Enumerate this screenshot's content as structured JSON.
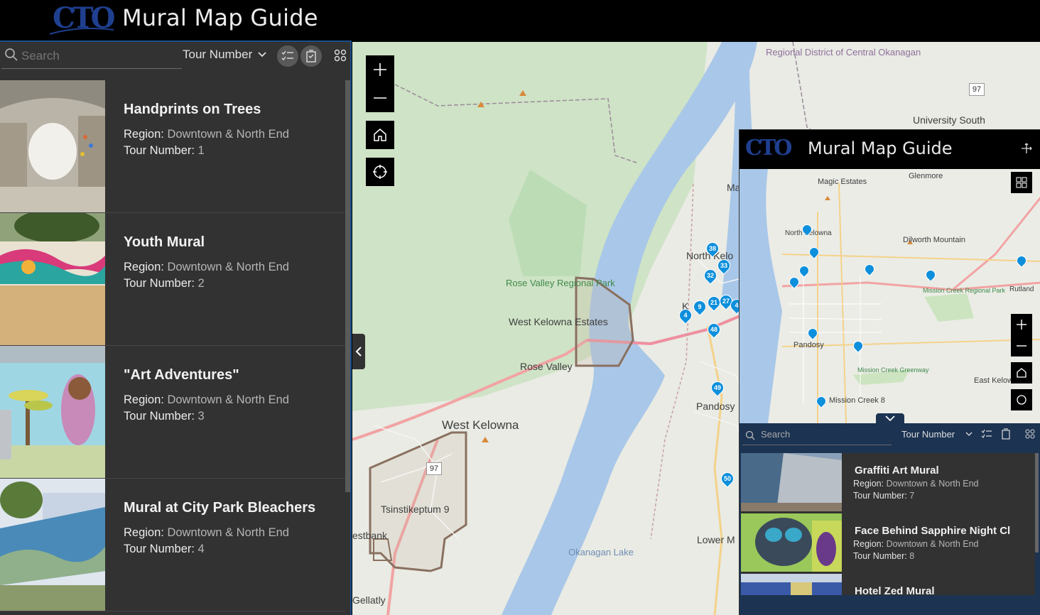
{
  "header": {
    "logo_text": "CTO",
    "title": "Mural Map Guide"
  },
  "toolbar": {
    "search_placeholder": "Search",
    "sort_label": "Tour Number",
    "icons": [
      "search-icon",
      "chevron-down-icon",
      "select-all-icon",
      "clear-selection-icon",
      "grid-view-icon"
    ]
  },
  "murals": [
    {
      "title": "Handprints on Trees",
      "region_label": "Region:",
      "region": "Downtown & North End",
      "tour_label": "Tour Number:",
      "tour": "1"
    },
    {
      "title": "Youth Mural",
      "region_label": "Region:",
      "region": "Downtown & North End",
      "tour_label": "Tour Number:",
      "tour": "2"
    },
    {
      "title": "\"Art Adventures\"",
      "region_label": "Region:",
      "region": "Downtown & North End",
      "tour_label": "Tour Number:",
      "tour": "3"
    },
    {
      "title": "Mural at City Park Bleachers",
      "region_label": "Region:",
      "region": "Downtown & North End",
      "tour_label": "Tour Number:",
      "tour": "4"
    }
  ],
  "map": {
    "controls": [
      "zoom-in-icon",
      "zoom-out-icon",
      "home-icon",
      "locate-icon"
    ],
    "labels": {
      "regional_district": "Regional District of Central Okanagan",
      "university_south": "University South",
      "rose_valley_park": "Rose Valley Regional Park",
      "west_kelowna_estates": "West Kelowna Estates",
      "rose_valley": "Rose Valley",
      "west_kelowna": "West Kelowna",
      "tsinstikeptum": "Tsinstikeptum 9",
      "westbank": "estbank",
      "gellatly": "Gellatly",
      "okanagan_lake": "Okanagan Lake",
      "north_kelowna": "North Kelo",
      "pandosy": "Pandosy",
      "lower_mission": "Lower M",
      "ma": "Ma",
      "k": "K"
    },
    "highways": [
      "97",
      "97"
    ],
    "pins": [
      "38",
      "33",
      "32",
      "21",
      "27",
      "4",
      "9",
      "4",
      "48",
      "49",
      "50"
    ]
  },
  "mobile_preview": {
    "logo_text": "CTO",
    "title": "Mural Map Guide",
    "labels": {
      "glenmore": "Glenmore",
      "magic_estates": "Magic Estates",
      "north_kelowna": "North Kelowna",
      "dilworth": "Dilworth Mountain",
      "rutland": "Rutland",
      "mission_creek_park": "Mission Creek Regional Park",
      "pandosy": "Pandosy",
      "mission_creek_greenway": "Mission Creek Greenway",
      "east_kelowna": "East Kelown",
      "mission_creek_8": "Mission Creek 8"
    },
    "search_placeholder": "Search",
    "sort_label": "Tour Number",
    "murals": [
      {
        "title": "Graffiti Art Mural",
        "region_label": "Region:",
        "region": "Downtown & North End",
        "tour_label": "Tour Number:",
        "tour": "7"
      },
      {
        "title": "Face Behind Sapphire Night Cl",
        "region_label": "Region:",
        "region": "Downtown & North End",
        "tour_label": "Tour Number:",
        "tour": "8"
      },
      {
        "title": "Hotel Zed Mural",
        "region_label": "",
        "region": "",
        "tour_label": "",
        "tour": ""
      }
    ]
  },
  "colors": {
    "accent": "#1a4f8a",
    "panel": "#323232",
    "pin": "#0d8fdc",
    "lake": "#a9c7e8",
    "park": "#cde4c0",
    "road": "#f0a8a8"
  }
}
